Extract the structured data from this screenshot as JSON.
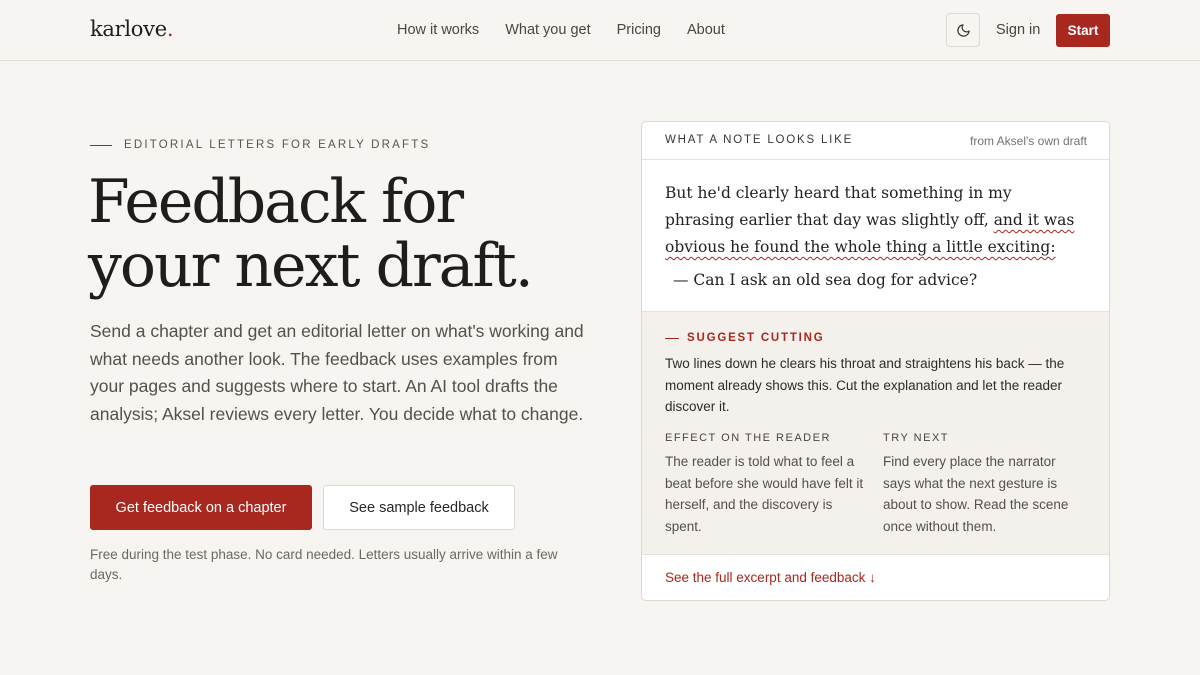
{
  "header": {
    "logo": "karlove",
    "logo_dot": ".",
    "nav": [
      "How it works",
      "What you get",
      "Pricing",
      "About"
    ],
    "signin": "Sign in",
    "start": "Start",
    "theme_icon": "moon-icon"
  },
  "hero": {
    "eyebrow": "EDITORIAL LETTERS FOR EARLY DRAFTS",
    "title_line1": "Feedback for",
    "title_line2": "your next draft.",
    "lede": "Send a chapter and get an editorial letter on what's working and what needs another look. The feedback uses examples from your pages and suggests where to start. An AI tool drafts the analysis; Aksel reviews every letter. You decide what to change.",
    "cta_primary": "Get feedback on a chapter",
    "cta_secondary": "See sample feedback",
    "fineprint": "Free during the test phase. No card needed. Letters usually arrive within a few days."
  },
  "card": {
    "label": "WHAT A NOTE LOOKS LIKE",
    "source": "from Aksel's own draft",
    "excerpt_plain": "But he'd clearly heard that something in my phrasing earlier that day was slightly off, ",
    "excerpt_marked": "and it was obvious he found the whole thing a little exciting:",
    "excerpt_dialogue": "— Can I ask an old sea dog for advice?",
    "note_tag": "SUGGEST CUTTING",
    "note_body": "Two lines down he clears his throat and straightens his back — the moment already shows this. Cut the explanation and let the reader discover it.",
    "effect_title": "EFFECT ON THE READER",
    "effect_body": "The reader is told what to feel a beat before she would have felt it herself, and the discovery is spent.",
    "try_title": "TRY NEXT",
    "try_body": "Find every place the narrator says what the next gesture is about to show. Read the scene once without them.",
    "footer_link": "See the full excerpt and feedback ↓"
  },
  "colors": {
    "accent": "#a8271f",
    "background": "#f7f5f1"
  }
}
